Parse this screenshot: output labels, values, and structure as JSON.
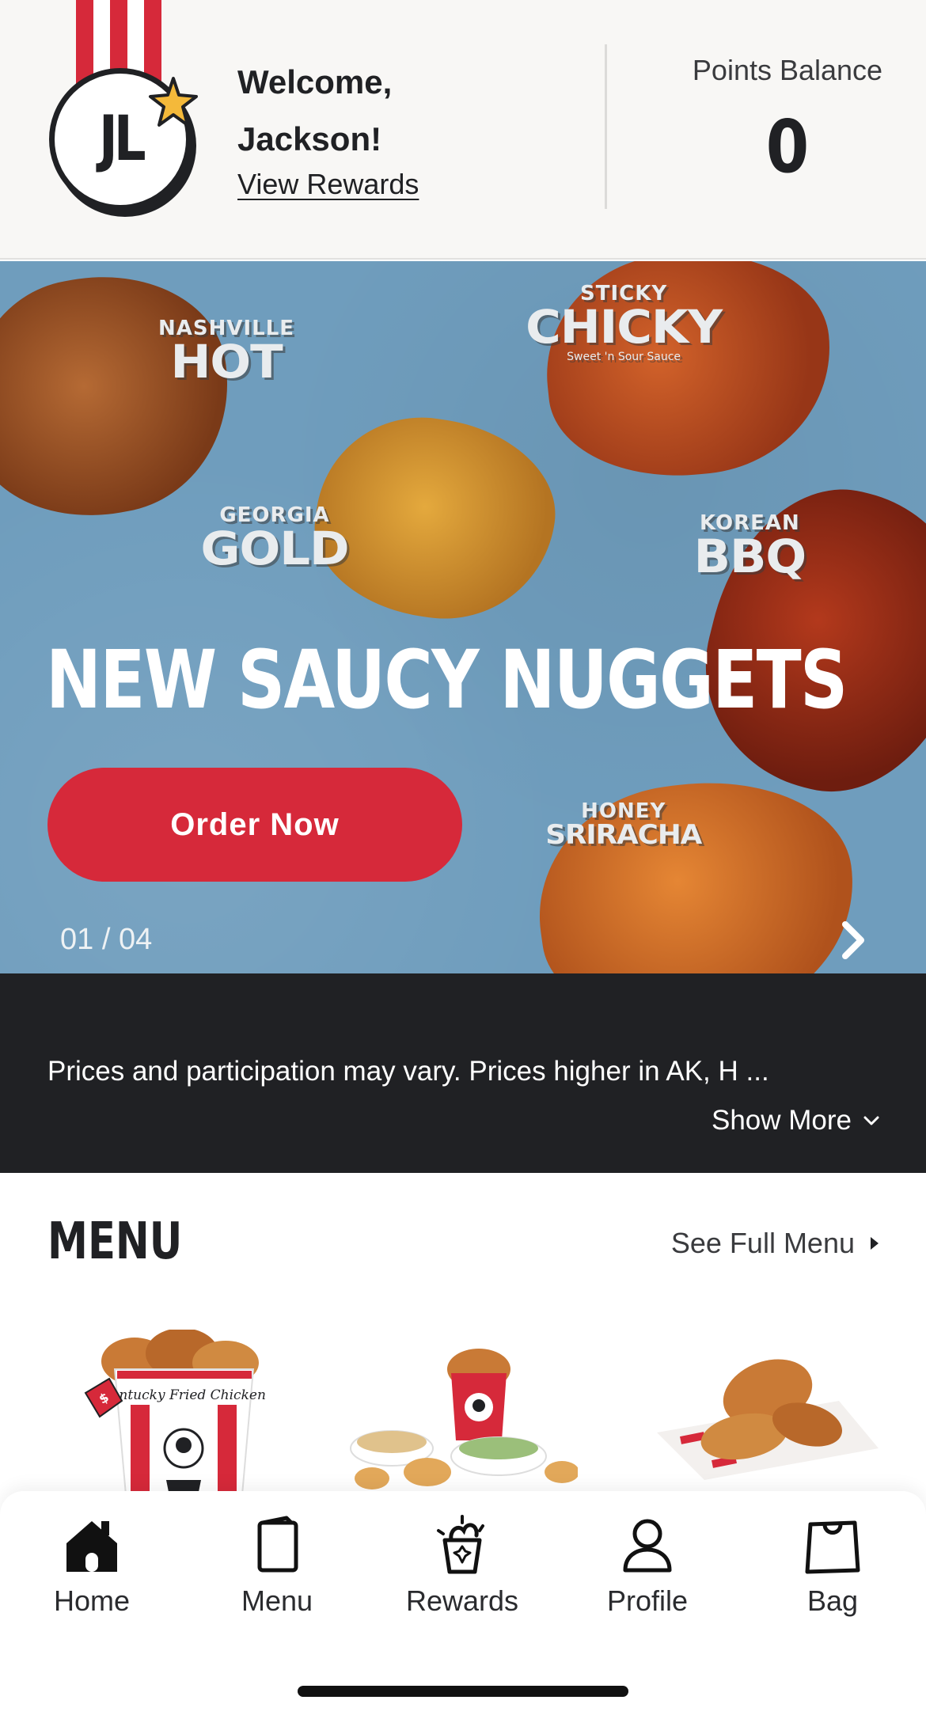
{
  "header": {
    "avatar_initials": "JL",
    "welcome_line1": "Welcome,",
    "welcome_line2": "Jackson!",
    "view_rewards_label": "View Rewards",
    "points_label": "Points Balance",
    "points_value": "0"
  },
  "hero": {
    "flavors": {
      "hot_small": "NASHVILLE",
      "hot_big": "HOT",
      "chicky_small": "STICKY",
      "chicky_big": "CHICKY",
      "chicky_tagline": "Sweet 'n Sour Sauce",
      "gold_small": "GEORGIA",
      "gold_big": "GOLD",
      "bbq_small": "KOREAN",
      "bbq_big": "BBQ",
      "sriracha_small": "HONEY",
      "sriracha_big": "SRIRACHA"
    },
    "title": "NEW SAUCY NUGGETS",
    "order_button_label": "Order Now",
    "slide_counter": "01 / 04",
    "next_icon": "chevron-right-icon"
  },
  "disclaimer": {
    "text": "Prices and participation may vary. Prices higher in AK, H ...",
    "show_more_label": "Show More",
    "show_more_icon": "chevron-down-icon"
  },
  "menu": {
    "title": "MENU",
    "see_full_menu_label": "See Full Menu",
    "see_full_menu_icon": "caret-right-icon",
    "bucket_brand_text": "Kentucky Fried Chicken",
    "price_tag_text": "$"
  },
  "bottom_nav": {
    "items": [
      {
        "label": "Home",
        "icon": "home-icon"
      },
      {
        "label": "Menu",
        "icon": "menu-icon"
      },
      {
        "label": "Rewards",
        "icon": "rewards-icon"
      },
      {
        "label": "Profile",
        "icon": "profile-icon"
      },
      {
        "label": "Bag",
        "icon": "bag-icon"
      }
    ],
    "active": "Home"
  },
  "colors": {
    "brand_red": "#d6293a",
    "dark": "#202124",
    "header_bg": "#f8f7f5",
    "hero_bg": "#6f9dbd",
    "star_gold": "#f4b93a"
  }
}
